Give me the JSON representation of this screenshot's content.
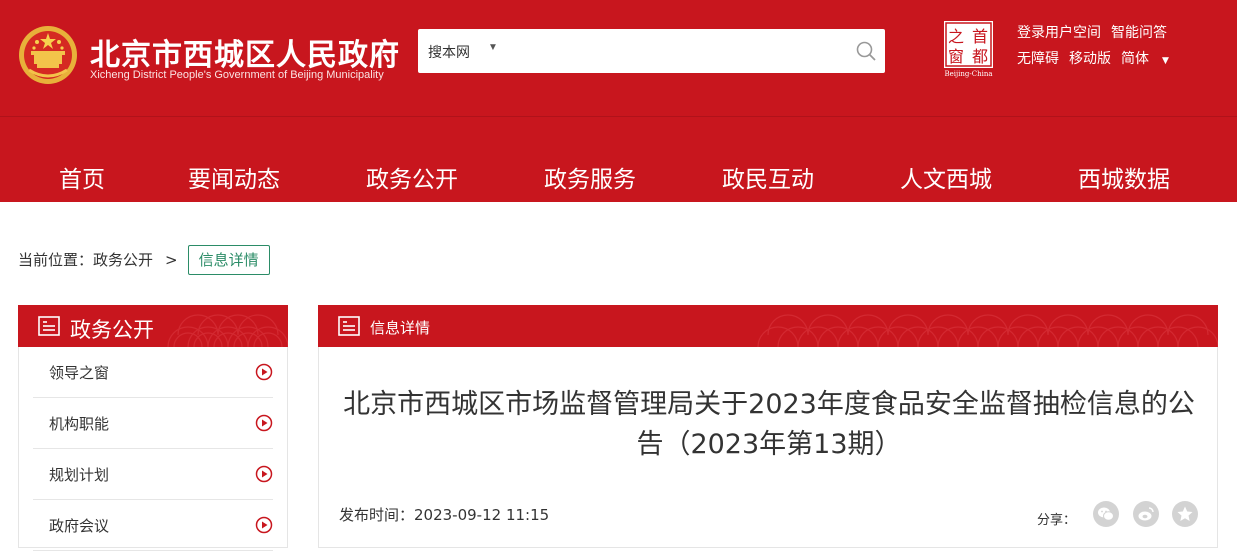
{
  "header": {
    "site_name_cn": "北京市西城区人民政府",
    "site_name_en": "Xicheng District People's Government of Beijing Municipality",
    "capital_logo_text": [
      "之",
      "首",
      "窗",
      "都"
    ],
    "capital_logo_caption": "Beijing-China",
    "top_links_row1": [
      "登录用户空间",
      "智能问答"
    ],
    "top_links_row2": [
      "无障碍",
      "移动版",
      "简体"
    ]
  },
  "search": {
    "scope_label": "搜本网",
    "placeholder": ""
  },
  "nav": {
    "items": [
      "首页",
      "要闻动态",
      "政务公开",
      "政务服务",
      "政民互动",
      "人文西城",
      "西城数据"
    ]
  },
  "breadcrumb": {
    "prefix": "当前位置：政务公开",
    "separator": ">",
    "current": "信息详情"
  },
  "sidebar": {
    "title": "政务公开",
    "items": [
      "领导之窗",
      "机构职能",
      "规划计划",
      "政府会议"
    ]
  },
  "article": {
    "section_title": "信息详情",
    "title": "北京市西城区市场监督管理局关于2023年度食品安全监督抽检信息的公告（2023年第13期）",
    "publish_time": "发布时间：2023-09-12 11:15",
    "share_label": "分享："
  },
  "colors": {
    "brand_red": "#c8161e",
    "breadcrumb_green": "#2b8c67",
    "share_gray": "#d3d3d3"
  },
  "icons": {
    "emblem": "national-emblem-icon",
    "search": "search-icon",
    "sidebar_arrow": "play-circle-icon",
    "section": "document-list-icon",
    "share": [
      "wechat-icon",
      "weibo-icon",
      "favorite-icon"
    ]
  }
}
